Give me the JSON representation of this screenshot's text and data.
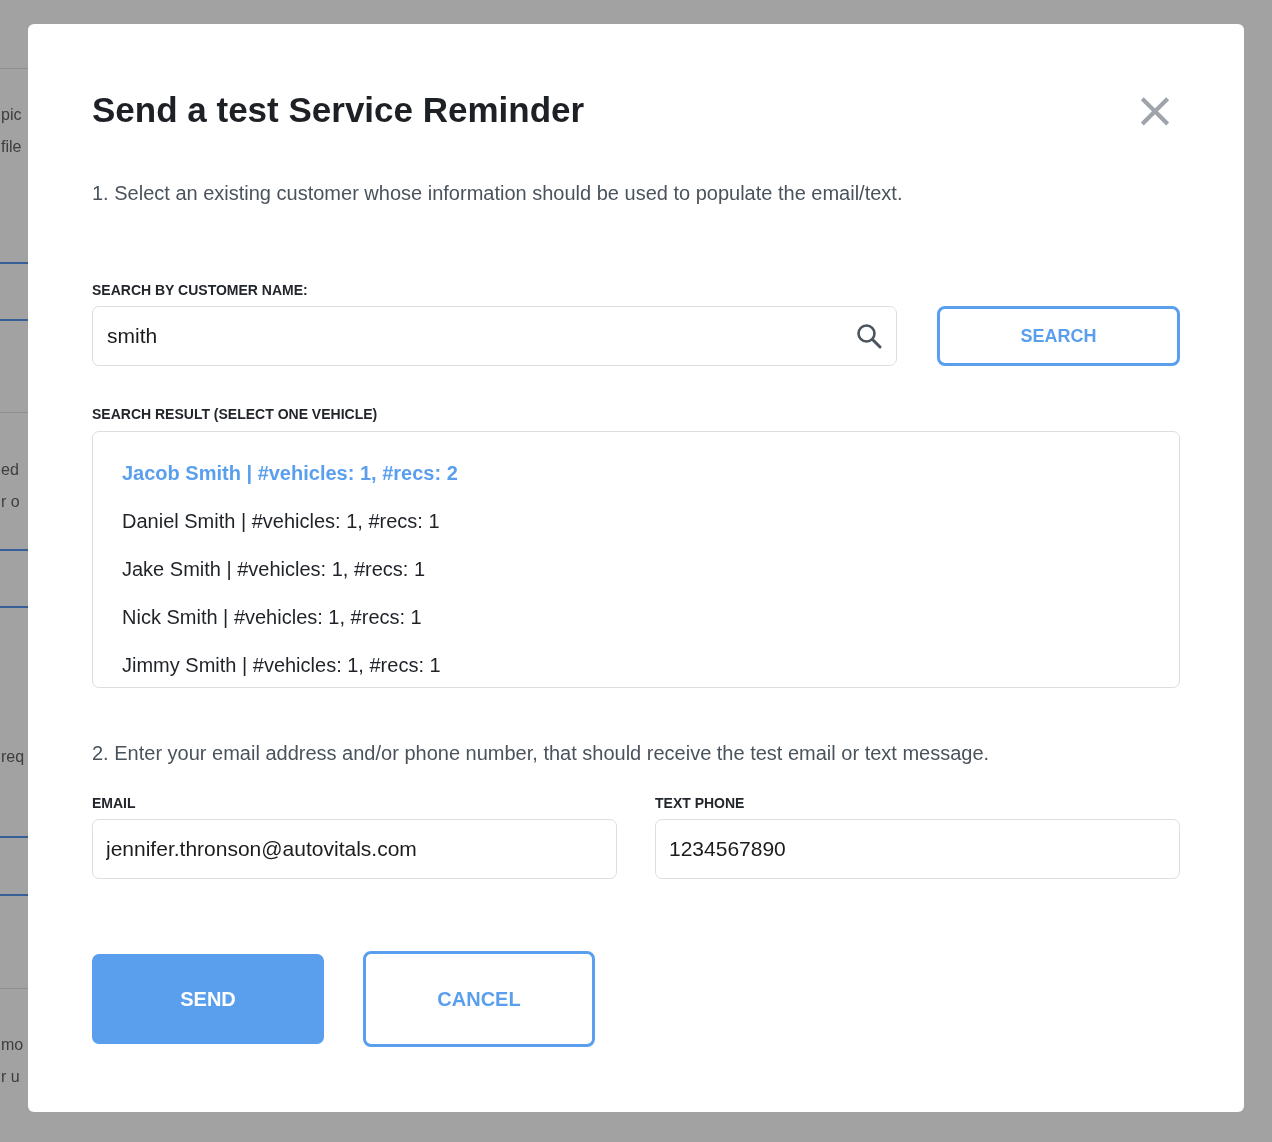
{
  "background": {
    "fragments": [
      "pic",
      "file",
      "ed",
      "r o",
      "req",
      "mo",
      "r u"
    ]
  },
  "dialog": {
    "title": "Send a test Service Reminder",
    "close": "×",
    "step1": "1. Select an existing customer whose information should be used to populate the email/text.",
    "search": {
      "label": "SEARCH BY CUSTOMER NAME:",
      "value": "smith",
      "button": "SEARCH"
    },
    "results": {
      "label": "SEARCH RESULT (SELECT ONE VEHICLE)",
      "items": [
        {
          "text": "Jacob Smith | #vehicles: 1, #recs: 2",
          "selected": true
        },
        {
          "text": "Daniel Smith | #vehicles: 1, #recs: 1",
          "selected": false
        },
        {
          "text": "Jake Smith | #vehicles: 1, #recs: 1",
          "selected": false
        },
        {
          "text": "Nick Smith | #vehicles: 1, #recs: 1",
          "selected": false
        },
        {
          "text": "Jimmy Smith | #vehicles: 1, #recs: 1",
          "selected": false
        }
      ]
    },
    "step2": "2. Enter your email address and/or phone number, that should receive the test email or text message.",
    "email": {
      "label": "EMAIL",
      "value": "jennifer.thronson@autovitals.com"
    },
    "phone": {
      "label": "TEXT PHONE",
      "value": "1234567890"
    },
    "buttons": {
      "send": "SEND",
      "cancel": "CANCEL"
    }
  }
}
